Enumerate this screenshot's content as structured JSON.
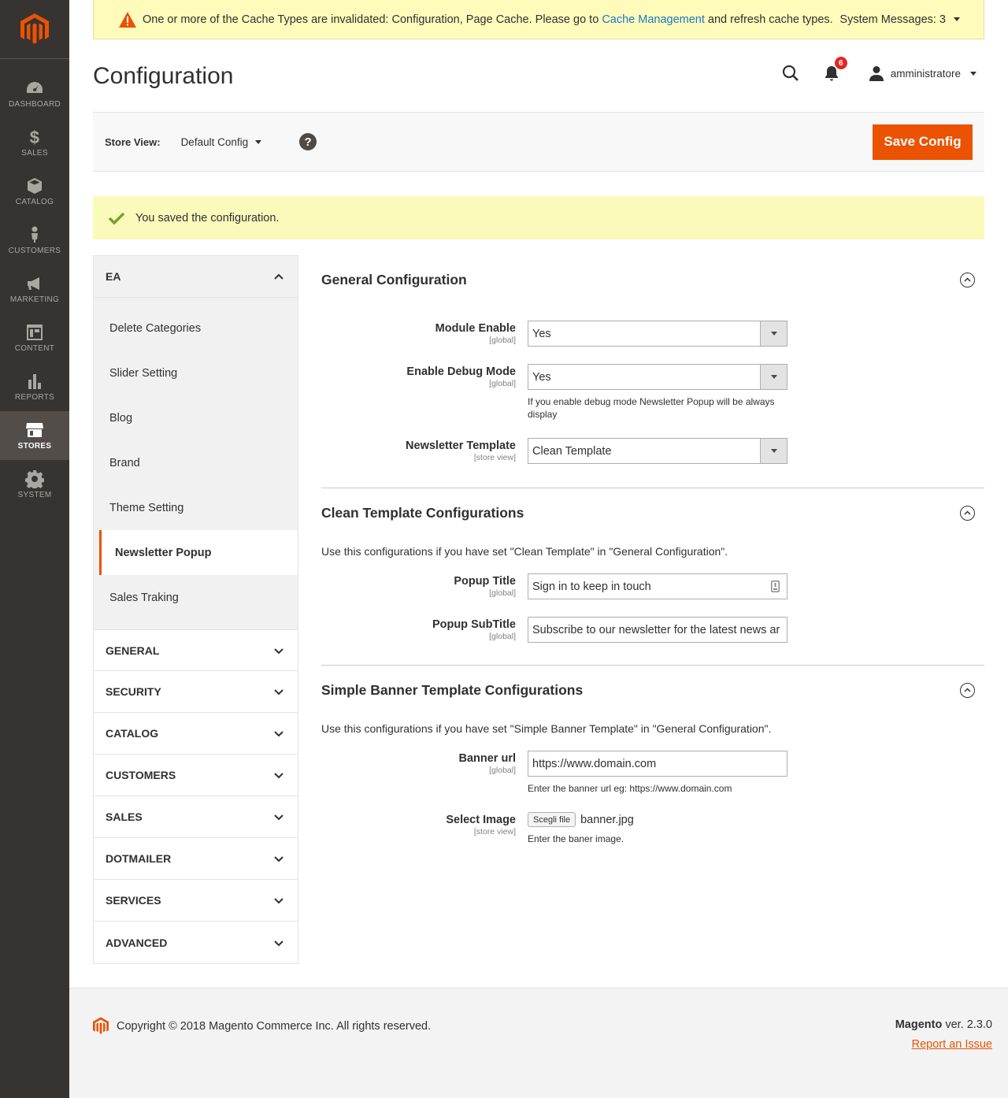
{
  "nav": {
    "items": [
      {
        "label": "DASHBOARD",
        "icon": "dashboard-icon"
      },
      {
        "label": "SALES",
        "icon": "dollar-icon"
      },
      {
        "label": "CATALOG",
        "icon": "cube-icon"
      },
      {
        "label": "CUSTOMERS",
        "icon": "person-icon"
      },
      {
        "label": "MARKETING",
        "icon": "megaphone-icon"
      },
      {
        "label": "CONTENT",
        "icon": "layout-icon"
      },
      {
        "label": "REPORTS",
        "icon": "bar-chart-icon"
      },
      {
        "label": "STORES",
        "icon": "store-icon"
      },
      {
        "label": "SYSTEM",
        "icon": "gear-icon"
      }
    ]
  },
  "system_message": {
    "text_before": "One or more of the Cache Types are invalidated: Configuration, Page Cache. Please go to",
    "link": "Cache Management",
    "text_after": "and refresh cache types.",
    "count_label": "System Messages: 3"
  },
  "header": {
    "title": "Configuration",
    "notifications_count": "6",
    "user": "amministratore"
  },
  "store_view": {
    "label": "Store View:",
    "value": "Default Config",
    "help": "?",
    "save_label": "Save Config"
  },
  "success_message": "You saved the configuration.",
  "tabs": {
    "ea": {
      "label": "EA",
      "items": [
        "Delete Categories",
        "Slider Setting",
        "Blog",
        "Brand",
        "Theme Setting",
        "Newsletter Popup",
        "Sales Traking"
      ]
    },
    "groups": [
      "GENERAL",
      "SECURITY",
      "CATALOG",
      "CUSTOMERS",
      "SALES",
      "DOTMAILER",
      "SERVICES",
      "ADVANCED"
    ]
  },
  "sections": {
    "general": {
      "title": "General Configuration",
      "module_enable": {
        "label": "Module Enable",
        "scope": "[global]",
        "value": "Yes"
      },
      "debug_mode": {
        "label": "Enable Debug Mode",
        "scope": "[global]",
        "value": "Yes",
        "note": "If you enable debug mode Newsletter Popup will be always display"
      },
      "template": {
        "label": "Newsletter Template",
        "scope": "[store view]",
        "value": "Clean Template"
      }
    },
    "clean": {
      "title": "Clean Template Configurations",
      "desc": "Use this configurations if you have set \"Clean Template\" in \"General Configuration\".",
      "popup_title": {
        "label": "Popup Title",
        "scope": "[global]",
        "value": "Sign in to keep in touch"
      },
      "popup_subtitle": {
        "label": "Popup SubTitle",
        "scope": "[global]",
        "value": "Subscribe to our newsletter for the latest news ar"
      }
    },
    "banner": {
      "title": "Simple Banner Template Configurations",
      "desc": "Use this configurations if you have set \"Simple Banner Template\" in \"General Configuration\".",
      "banner_url": {
        "label": "Banner url",
        "scope": "[global]",
        "value": "https://www.domain.com",
        "note": "Enter the banner url eg: https://www.domain.com"
      },
      "select_image": {
        "label": "Select Image",
        "scope": "[store view]",
        "button": "Scegli file",
        "file": "banner.jpg",
        "note": "Enter the baner image."
      }
    }
  },
  "footer": {
    "copyright": "Copyright © 2018 Magento Commerce Inc. All rights reserved.",
    "brand": "Magento",
    "version": "ver. 2.3.0",
    "report": "Report an Issue"
  },
  "colors": {
    "accent": "#eb5202",
    "nav_bg": "#373330",
    "link": "#1979c3",
    "badge": "#e22626"
  }
}
